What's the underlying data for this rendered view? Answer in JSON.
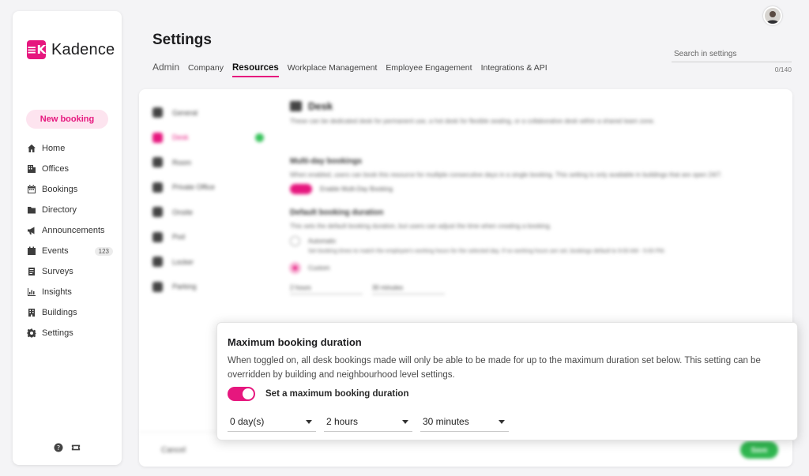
{
  "app": {
    "logo_text": "Kadence",
    "logo_mark": "≡K",
    "accent_color": "#e6177e"
  },
  "sidebar": {
    "new_booking_label": "New booking",
    "items": [
      {
        "label": "Home",
        "icon": "home-icon"
      },
      {
        "label": "Offices",
        "icon": "offices-icon"
      },
      {
        "label": "Bookings",
        "icon": "calendar-icon"
      },
      {
        "label": "Directory",
        "icon": "directory-icon"
      },
      {
        "label": "Announcements",
        "icon": "megaphone-icon"
      },
      {
        "label": "Events",
        "icon": "events-icon",
        "badge": "123"
      },
      {
        "label": "Surveys",
        "icon": "survey-icon"
      },
      {
        "label": "Insights",
        "icon": "chart-icon"
      },
      {
        "label": "Buildings",
        "icon": "building-icon"
      },
      {
        "label": "Settings",
        "icon": "gear-icon"
      }
    ],
    "bottom_icons": [
      "help-icon",
      "ticket-icon"
    ]
  },
  "header": {
    "title": "Settings",
    "tabs": [
      {
        "label": "Admin"
      },
      {
        "label": "Company"
      },
      {
        "label": "Resources",
        "active": true
      },
      {
        "label": "Workplace Management"
      },
      {
        "label": "Employee Engagement"
      },
      {
        "label": "Integrations & API"
      }
    ],
    "search": {
      "placeholder": "Search in settings",
      "value": "",
      "count": "0/140"
    }
  },
  "resources": {
    "items": [
      {
        "label": "General"
      },
      {
        "label": "Desk",
        "active": true
      },
      {
        "label": "Room"
      },
      {
        "label": "Private Office"
      },
      {
        "label": "Onsite"
      },
      {
        "label": "Pod"
      },
      {
        "label": "Locker"
      },
      {
        "label": "Parking"
      }
    ],
    "status_color": "#37c25b"
  },
  "desk": {
    "title": "Desk",
    "description": "These can be dedicated desk for permanent use, a hot desk for flexible seating, or a collaborative desk within a shared team zone.",
    "multi_day_title": "Multi-day bookings",
    "multi_day_desc": "When enabled, users can book this resource for multiple consecutive days in a single booking. This setting is only available in buildings that are open 24/7.",
    "multi_day_toggle_label": "Enable Multi-Day Booking",
    "default_duration_title": "Default booking duration",
    "default_duration_desc": "This sets the default booking duration, but users can adjust the time when creating a booking.",
    "automatic_label": "Automatic",
    "automatic_desc": "Set booking times to match the employee's working hours for the selected day. If no working hours are set, bookings default to 9:00 AM - 5:00 PM.",
    "custom_label": "Custom",
    "custom_hours": "2 hours",
    "custom_minutes": "30 minutes"
  },
  "footer": {
    "cancel_label": "Cancel",
    "save_label": "Save"
  },
  "modal": {
    "title": "Maximum booking duration",
    "description": "When toggled on, all desk bookings made will only be able to be made for up to the maximum duration set below. This setting can be overridden by building and neighbourhood level settings.",
    "toggle_label": "Set a maximum booking duration",
    "toggle_on": true,
    "days": "0 day(s)",
    "hours": "2 hours",
    "minutes": "30 minutes"
  }
}
